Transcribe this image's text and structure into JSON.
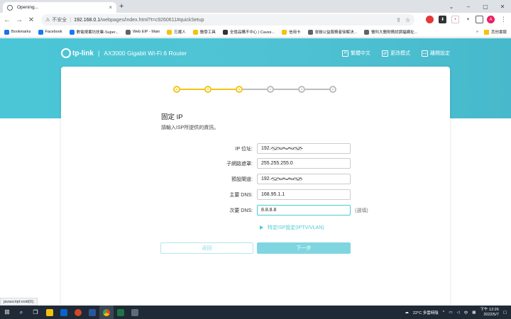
{
  "browser": {
    "tab_title": "Opening...",
    "tab_close": "×",
    "new_tab": "+",
    "url_security": "不安全",
    "url_host": "192.168.0.1",
    "url_path": "/webpages/index.html?t=c9260611#quickSetup",
    "profile_initial": "A",
    "bookmarks": [
      {
        "label": "Bookmarks",
        "color": "#1a73e8"
      },
      {
        "label": "Facebook",
        "color": "#1877f2"
      },
      {
        "label": "數電視書坊扶業-Super...",
        "color": "#1877f2"
      },
      {
        "label": "Web EIP - Main",
        "color": "#5f6368"
      },
      {
        "label": "忘護人",
        "color": "#f4c20d"
      },
      {
        "label": "醫學工具",
        "color": "#f4c20d"
      },
      {
        "label": "全億品購不中心 | Caves...",
        "color": "#333333"
      },
      {
        "label": "信用卡",
        "color": "#f4c20d"
      },
      {
        "label": "會融公益服務者徐解決...",
        "color": "#5f6368"
      },
      {
        "label": "醫科大醫財務試調福網址...",
        "color": "#5f6368"
      }
    ],
    "other_bookmarks": "其他書籤",
    "status_text": "javascript:void(0);"
  },
  "router": {
    "brand": "tp-link",
    "model": "AX3000 Gigabit Wi-Fi 6 Router",
    "header_links": [
      {
        "label": "繁體中文",
        "icon": "language-icon"
      },
      {
        "label": "更改模式",
        "icon": "switch-mode-icon"
      },
      {
        "label": "離開設定",
        "icon": "exit-icon"
      }
    ],
    "steps": {
      "total": 6,
      "completed": 3
    },
    "title": "固定 IP",
    "subtitle": "請輸入ISP所提供的資訊。",
    "fields": [
      {
        "label": "IP 位址:",
        "value": "192.",
        "redacted": true
      },
      {
        "label": "子網路遮罩:",
        "value": "255.255.255.0",
        "redacted": false
      },
      {
        "label": "預設閘道:",
        "value": "192.",
        "redacted": true
      },
      {
        "label": "主要 DNS:",
        "value": "168.95.1.1",
        "redacted": false
      },
      {
        "label": "次要 DNS:",
        "value": "8.8.8.8",
        "redacted": false,
        "hint": "(選填)"
      }
    ],
    "isp_link": "特定ISP設定(IPTV/VLAN)",
    "back_button": "返回",
    "next_button": "下一步",
    "colors": {
      "accent": "#4acbd6",
      "step_done": "#f5c518",
      "step_todo": "#bdbdbd"
    }
  },
  "taskbar": {
    "weather": "22°C 多雲時陰",
    "ime": "中",
    "time": "下午 12:26",
    "date": "2022/5/7"
  }
}
